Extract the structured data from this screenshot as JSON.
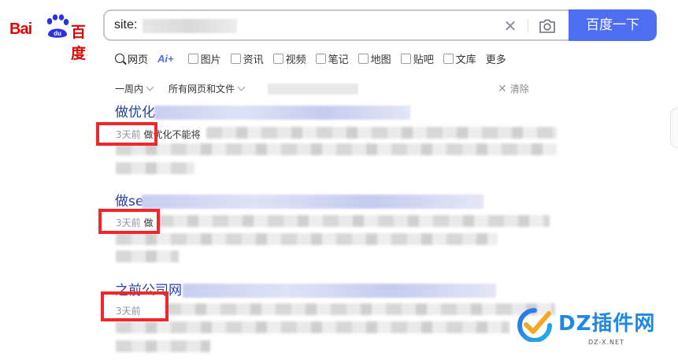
{
  "logo": {
    "latin": "Bai",
    "paw_text": "du",
    "chinese": "百度"
  },
  "search": {
    "query": "site:",
    "button_label": "百度一下"
  },
  "tabs": [
    {
      "label": "网页"
    },
    {
      "label": "Ai+"
    },
    {
      "label": "图片"
    },
    {
      "label": "资讯"
    },
    {
      "label": "视频"
    },
    {
      "label": "笔记"
    },
    {
      "label": "地图"
    },
    {
      "label": "贴吧"
    },
    {
      "label": "文库"
    },
    {
      "label": "更多"
    }
  ],
  "filters": {
    "time": "一周内",
    "scope": "所有网页和文件",
    "clear": "清除"
  },
  "results": [
    {
      "title": "做优化",
      "date": "3天前",
      "snippet": "做优化不能将"
    },
    {
      "title": "做se",
      "date": "3天前",
      "snippet": "做"
    },
    {
      "title": "之前公司网",
      "date": "3天前",
      "snippet": ""
    }
  ],
  "watermark": {
    "brand": "DZ插件网",
    "url": "DZ-X.NET"
  },
  "colors": {
    "accent": "#4e6ef2",
    "brand_red": "#e10602",
    "link": "#2440b3",
    "highlight": "#f1272c"
  }
}
